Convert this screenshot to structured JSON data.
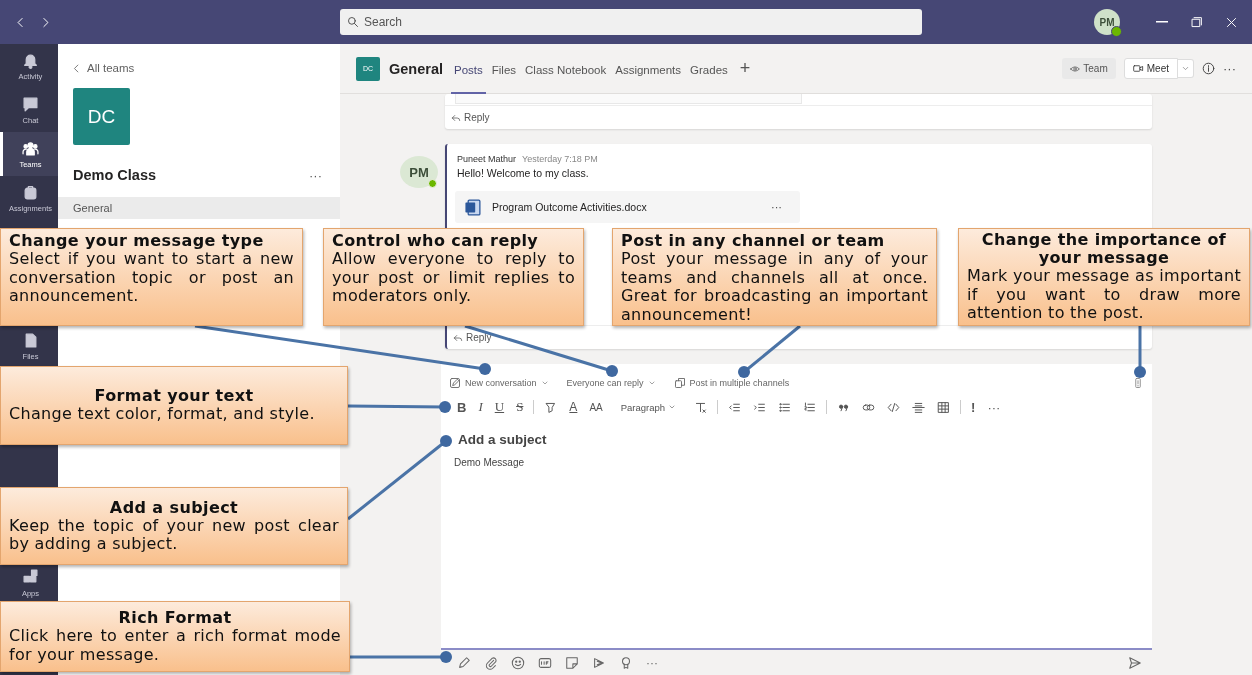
{
  "title_bar": {
    "search": {
      "placeholder": "Search"
    },
    "avatar": "PM"
  },
  "rail": [
    {
      "label": "Activity",
      "selected": false
    },
    {
      "label": "Chat",
      "selected": false
    },
    {
      "label": "Teams",
      "selected": true
    },
    {
      "label": "Assignments",
      "selected": false
    },
    {
      "label": "Files",
      "selected": false
    },
    {
      "label": "Apps",
      "selected": false
    }
  ],
  "team_panel": {
    "back": "All teams",
    "tile": "DC",
    "team_name": "Demo Class",
    "more": "···",
    "channels": [
      {
        "name": "General",
        "selected": true
      }
    ]
  },
  "channel_header": {
    "tile": "DC",
    "name": "General",
    "tabs": [
      {
        "label": "Posts",
        "selected": true
      },
      {
        "label": "Files",
        "selected": false
      },
      {
        "label": "Class Notebook",
        "selected": false
      },
      {
        "label": "Assignments",
        "selected": false
      },
      {
        "label": "Grades",
        "selected": false
      }
    ],
    "add": "+",
    "team_button": "Team",
    "meet_button": "Meet",
    "more": "···"
  },
  "posts": [
    {
      "kind": "partial",
      "reply": "Reply"
    },
    {
      "kind": "full",
      "avatar": "PM",
      "author": "Puneet Mathur",
      "time": "Yesterday 7:18 PM",
      "text": "Hello! Welcome to my class.",
      "attachment": {
        "name": "Program Outcome Activities.docx",
        "more": "···"
      },
      "reply": "Reply"
    }
  ],
  "composer": {
    "options": [
      {
        "kind": "type",
        "label": "New conversation"
      },
      {
        "kind": "reply",
        "label": "Everyone can reply"
      },
      {
        "kind": "channels",
        "label": "Post in multiple channels"
      }
    ],
    "format_toolbar": [
      {
        "kind": "bold",
        "label": "B"
      },
      {
        "kind": "italic",
        "label": "I"
      },
      {
        "kind": "underline",
        "label": "U"
      },
      {
        "kind": "strike",
        "label": "S"
      },
      {
        "kind": "separator"
      },
      {
        "kind": "highlight"
      },
      {
        "kind": "font-color",
        "label": "A"
      },
      {
        "kind": "font-size",
        "label": "AA"
      },
      {
        "kind": "paragraph",
        "label": "Paragraph"
      },
      {
        "kind": "clear-format"
      },
      {
        "kind": "separator"
      },
      {
        "kind": "outdent"
      },
      {
        "kind": "indent"
      },
      {
        "kind": "bullets"
      },
      {
        "kind": "numbering"
      },
      {
        "kind": "separator"
      },
      {
        "kind": "quote"
      },
      {
        "kind": "link"
      },
      {
        "kind": "code"
      },
      {
        "kind": "rule"
      },
      {
        "kind": "table"
      },
      {
        "kind": "separator"
      },
      {
        "kind": "important",
        "label": "!"
      },
      {
        "kind": "more",
        "label": "···"
      }
    ],
    "subject": {
      "placeholder": "Add a subject"
    },
    "message": "Demo Message",
    "more": "···"
  },
  "callouts": [
    {
      "title": "Change your message type",
      "text": "Select if you want to start a new conversation topic or post an announcement."
    },
    {
      "title": "Control who can reply",
      "text": "Allow everyone to reply to your post or limit replies to moderators only."
    },
    {
      "title": "Post in any channel or team",
      "text": "Post your message in any of your teams and channels all at once. Great for broadcasting an important announcement!"
    },
    {
      "title": "Change the importance of your message",
      "text": "Mark your message as important if you want to draw more attention to the post."
    },
    {
      "title": "Format your text",
      "text": "Change text color, format, and style."
    },
    {
      "title": "Add a subject",
      "text": "Keep the topic of your new post clear by adding a subject."
    },
    {
      "title": "Rich Format",
      "text": "Click here to enter a rich format mode for your message."
    }
  ]
}
